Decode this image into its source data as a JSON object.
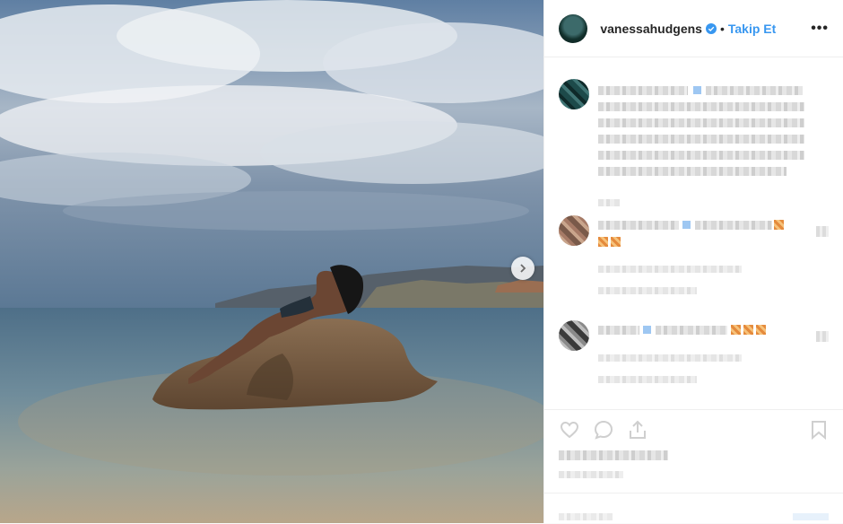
{
  "header": {
    "username": "vanessahudgens",
    "separator": "•",
    "follow_label": "Takip Et",
    "more_label": "•••"
  },
  "colors": {
    "accent": "#3897f0",
    "text": "#262626",
    "divider": "#efefef"
  },
  "icons": [
    "verified-badge-icon",
    "chevron-right-icon",
    "heart-icon",
    "comment-icon",
    "share-icon",
    "bookmark-icon",
    "more-icon"
  ]
}
